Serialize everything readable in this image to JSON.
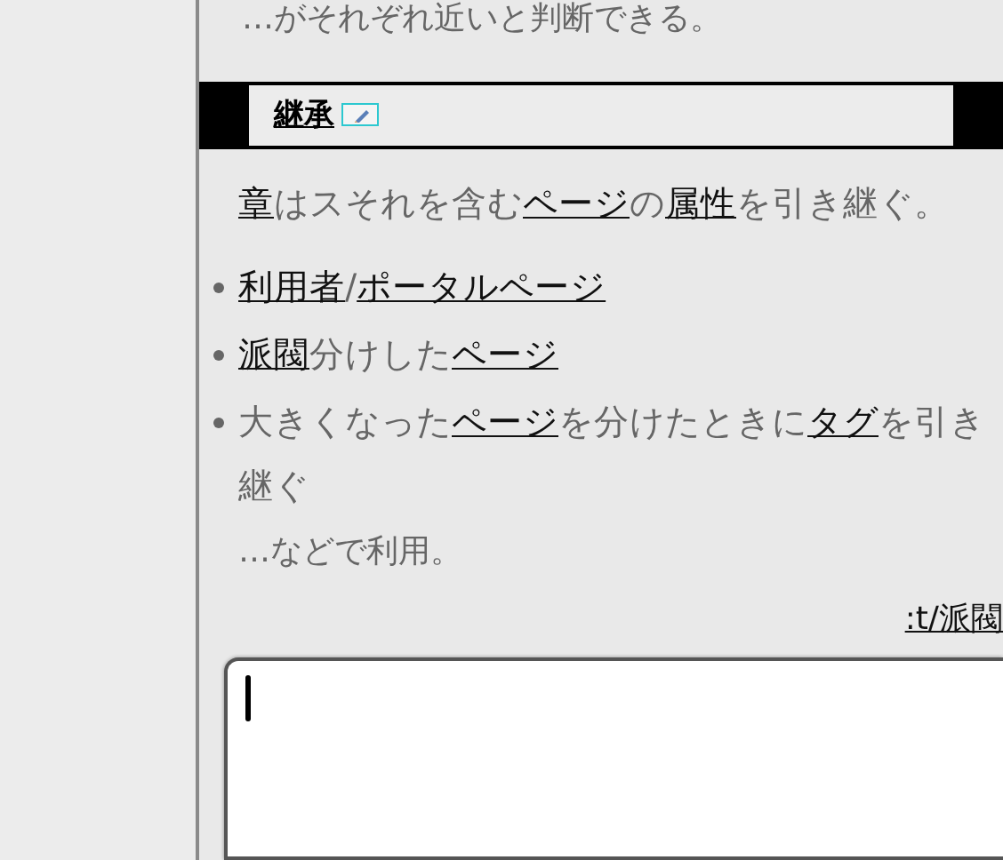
{
  "intro_tail": "…がそれぞれ近いと判断できる。",
  "section": {
    "heading": "継承"
  },
  "paragraph": [
    {
      "kind": "link",
      "text": "章"
    },
    {
      "kind": "text",
      "text": "はスそれを含む"
    },
    {
      "kind": "link",
      "text": "ページ"
    },
    {
      "kind": "text",
      "text": "の"
    },
    {
      "kind": "link",
      "text": "属性"
    },
    {
      "kind": "text",
      "text": "を引き継ぐ。"
    }
  ],
  "bullets": [
    [
      {
        "kind": "link",
        "text": "利用者"
      },
      {
        "kind": "text",
        "text": "/"
      },
      {
        "kind": "link",
        "text": "ポータルページ"
      }
    ],
    [
      {
        "kind": "link",
        "text": "派閥"
      },
      {
        "kind": "text",
        "text": "分けした"
      },
      {
        "kind": "link",
        "text": "ページ"
      }
    ],
    [
      {
        "kind": "text",
        "text": "大きくなった"
      },
      {
        "kind": "link",
        "text": "ページ"
      },
      {
        "kind": "text",
        "text": "を分けたときに"
      },
      {
        "kind": "link",
        "text": "タグ"
      },
      {
        "kind": "text",
        "text": "を引き継ぐ"
      }
    ]
  ],
  "closing": "…などで利用。",
  "tag_link": ":t/派閥",
  "editor": {
    "focused": true
  }
}
